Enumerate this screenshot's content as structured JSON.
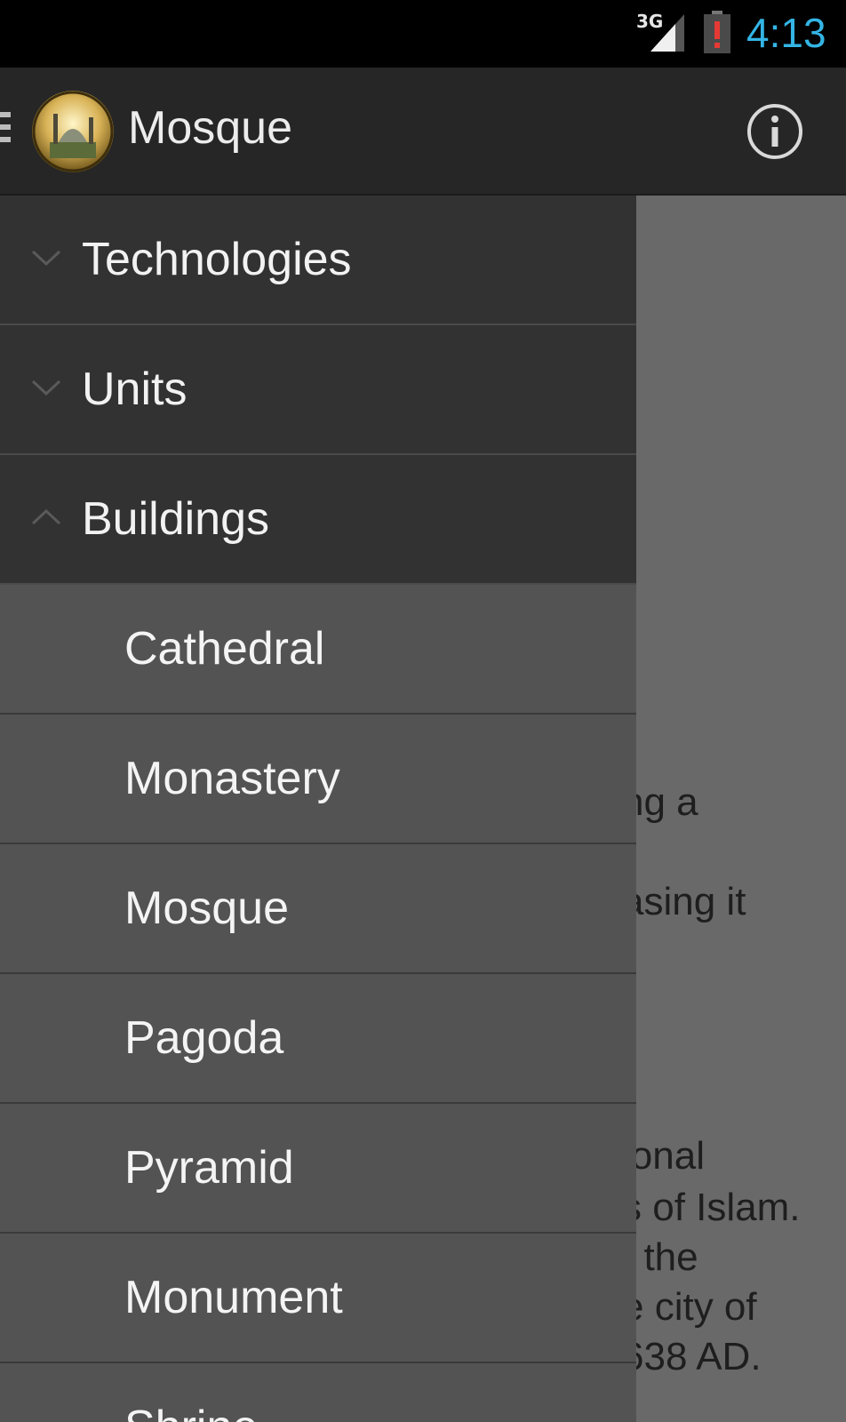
{
  "status_bar": {
    "network": "3G",
    "time": "4:13",
    "icons": [
      "signal-icon",
      "battery-alert-icon"
    ]
  },
  "action_bar": {
    "title": "Mosque",
    "icons": [
      "drawer-indicator-icon",
      "app-icon",
      "info-icon"
    ]
  },
  "drawer": {
    "groups": [
      {
        "label": "Technologies",
        "expanded": false
      },
      {
        "label": "Units",
        "expanded": false
      },
      {
        "label": "Buildings",
        "expanded": true
      }
    ],
    "buildings_children": [
      "Cathedral",
      "Monastery",
      "Mosque",
      "Pagoda",
      "Pyramid",
      "Monument",
      "Shrine"
    ]
  },
  "background_content": {
    "lines": [
      "ng a",
      "asing it",
      "ional",
      "s of Islam.",
      ". the",
      "e city of",
      "638 AD."
    ]
  },
  "colors": {
    "clock": "#33b5e5",
    "action_bar": "#262626",
    "drawer_group": "#323232",
    "drawer_child": "#525352",
    "scrim": "#696969"
  }
}
